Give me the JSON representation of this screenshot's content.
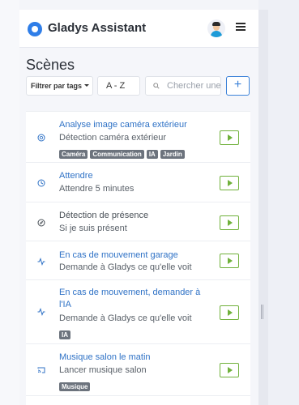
{
  "header": {
    "brand": "Gladys Assistant",
    "logo_icon": "gladys-logo-icon",
    "avatar_icon": "user-avatar-icon",
    "menu_icon": "hamburger-menu-icon"
  },
  "page": {
    "title": "Scènes"
  },
  "toolbar": {
    "filter_label": "Filtrer par tags",
    "sort_label": "A - Z",
    "search_placeholder": "Chercher une scène",
    "add_label": "+"
  },
  "scenes": [
    {
      "name": "Analyse image caméra extérieur",
      "description": "Détection caméra extérieur",
      "tags": [
        "Caméra",
        "Communication",
        "IA",
        "Jardin"
      ],
      "icon": "camera-lens-icon",
      "active": true
    },
    {
      "name": "Attendre",
      "description": "Attendre 5 minutes",
      "tags": [],
      "icon": "clock-icon",
      "active": true
    },
    {
      "name": "Détection de présence",
      "description": "Si je suis présent",
      "tags": [],
      "icon": "compass-icon",
      "active": false
    },
    {
      "name": "En cas de mouvement garage",
      "description": "Demande à Gladys ce qu'elle voit",
      "tags": [],
      "icon": "activity-icon",
      "active": true
    },
    {
      "name": "En cas de mouvement, demander à l'IA",
      "description": "Demande à Gladys ce qu'elle voit",
      "tags": [
        "IA"
      ],
      "icon": "activity-icon",
      "active": true
    },
    {
      "name": "Musique salon le matin",
      "description": "Lancer musique salon",
      "tags": [
        "Musique"
      ],
      "icon": "cast-icon",
      "active": true
    }
  ],
  "colors": {
    "accent": "#2f72c6",
    "play": "#70b13b",
    "tag": "#6c737d"
  }
}
